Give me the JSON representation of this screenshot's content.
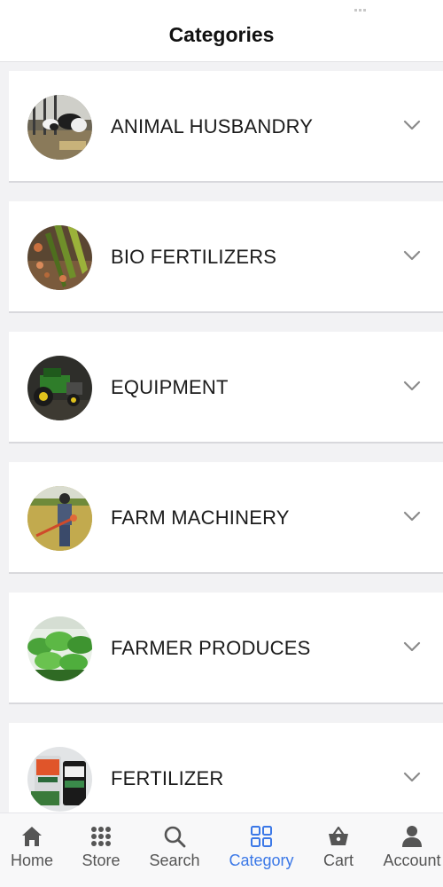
{
  "header": {
    "title": "Categories"
  },
  "categories": [
    {
      "label": "ANIMAL HUSBANDRY",
      "icon": "cows-photo"
    },
    {
      "label": "BIO FERTILIZERS",
      "icon": "seeds-photo"
    },
    {
      "label": "EQUIPMENT",
      "icon": "mower-photo"
    },
    {
      "label": "FARM MACHINERY",
      "icon": "farmer-photo"
    },
    {
      "label": "FARMER PRODUCES",
      "icon": "plants-photo"
    },
    {
      "label": "FERTILIZER",
      "icon": "fertilizer-bags-photo"
    }
  ],
  "tabbar": {
    "items": [
      {
        "label": "Home",
        "icon": "home-icon"
      },
      {
        "label": "Store",
        "icon": "grid-dots-icon"
      },
      {
        "label": "Search",
        "icon": "search-icon"
      },
      {
        "label": "Category",
        "icon": "category-icon",
        "active": true
      },
      {
        "label": "Cart",
        "icon": "basket-icon"
      },
      {
        "label": "Account",
        "icon": "person-icon"
      }
    ]
  },
  "colors": {
    "accent": "#3b78e7",
    "background": "#f2f2f4",
    "card": "#ffffff"
  }
}
